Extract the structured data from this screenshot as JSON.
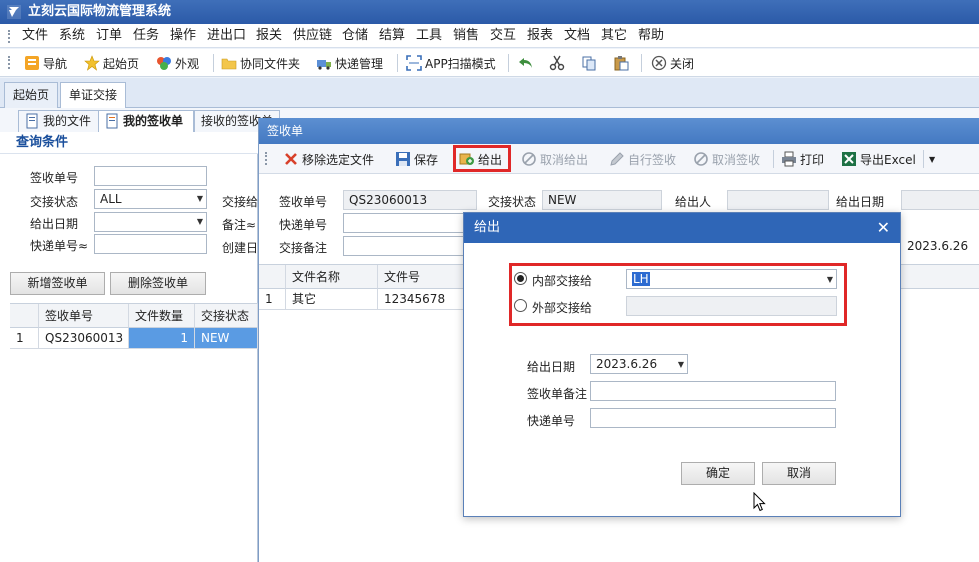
{
  "app": {
    "title": "立刻云国际物流管理系统"
  },
  "menu": [
    "文件",
    "系统",
    "订单",
    "任务",
    "操作",
    "进出口",
    "报关",
    "供应链",
    "仓储",
    "结算",
    "工具",
    "销售",
    "交互",
    "报表",
    "文档",
    "其它",
    "帮助"
  ],
  "toolbar": {
    "items": [
      {
        "label": "导航",
        "icon": "navigation-icon"
      },
      {
        "label": "起始页",
        "icon": "star-icon"
      },
      {
        "label": "外观",
        "icon": "palette-icon"
      },
      {
        "label": "协同文件夹",
        "icon": "folder-icon"
      },
      {
        "label": "快递管理",
        "icon": "courier-icon"
      },
      {
        "label": "APP扫描模式",
        "icon": "scan-icon"
      },
      {
        "label": "关闭",
        "icon": "close-circle-icon"
      }
    ]
  },
  "tabs_top": [
    "起始页",
    "单证交接"
  ],
  "tabs_sub": [
    "我的文件",
    "我的签收单",
    "接收的签收单"
  ],
  "query": {
    "title": "查询条件",
    "receipt_no_label": "签收单号",
    "status_label": "交接状态",
    "status_value": "ALL",
    "date_label": "给出日期",
    "courier_label": "快递单号≈",
    "add_button": "新增签收单",
    "delete_button": "删除签收单"
  },
  "left_grid": {
    "headers": [
      "签收单号",
      "文件数量",
      "交接状态"
    ],
    "rows": [
      {
        "no": "1",
        "receipt": "QS23060013",
        "count": "1",
        "status": "NEW"
      }
    ]
  },
  "partial_labels": {
    "transfer": "交接给",
    "remark": "备注≈",
    "created": "创建日"
  },
  "receipt_window": {
    "title": "签收单",
    "toolbar": [
      {
        "label": "移除选定文件",
        "icon": "remove-x-icon",
        "enabled": true
      },
      {
        "label": "保存",
        "icon": "save-icon",
        "enabled": true
      },
      {
        "label": "给出",
        "icon": "give-out-icon",
        "enabled": true
      },
      {
        "label": "取消给出",
        "icon": "cancel-icon",
        "enabled": false
      },
      {
        "label": "自行签收",
        "icon": "pen-icon",
        "enabled": false
      },
      {
        "label": "取消签收",
        "icon": "cancel-icon",
        "enabled": false
      },
      {
        "label": "打印",
        "icon": "printer-icon",
        "enabled": true
      },
      {
        "label": "导出Excel",
        "icon": "excel-icon",
        "enabled": true
      }
    ],
    "form": {
      "receipt_no_label": "签收单号",
      "receipt_no_value": "QS23060013",
      "status_label": "交接状态",
      "status_value": "NEW",
      "giver_label": "给出人",
      "give_date_label": "给出日期",
      "courier_label": "快递单号",
      "note_label": "交接备注",
      "date_partial": "2023.6.26"
    },
    "grid": {
      "headers": [
        "文件名称",
        "文件号"
      ],
      "rows": [
        {
          "no": "1",
          "name": "其它",
          "file_no": "12345678"
        }
      ]
    }
  },
  "dialog": {
    "title": "给出",
    "internal_label": "内部交接给",
    "internal_value": "LH",
    "external_label": "外部交接给",
    "date_label": "给出日期",
    "date_value": "2023.6.26",
    "remark_label": "签收单备注",
    "courier_label": "快递单号",
    "ok_button": "确定",
    "cancel_button": "取消"
  },
  "colors": {
    "title_blue": "#2b5aa8",
    "highlight_red": "#e02828",
    "selection_blue": "#5a9be3"
  }
}
